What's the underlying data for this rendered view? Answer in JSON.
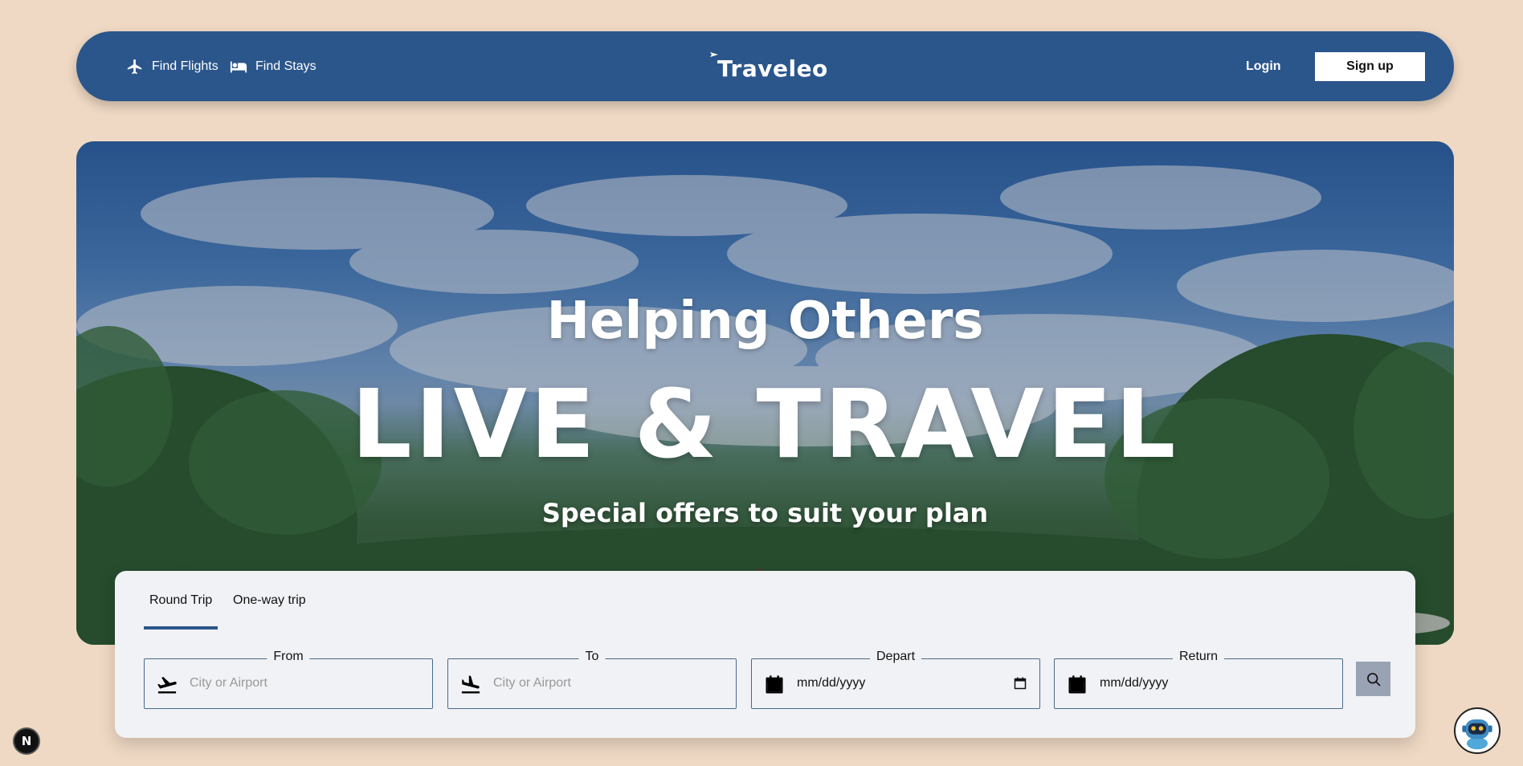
{
  "nav": {
    "flights_label": "Find Flights",
    "stays_label": "Find Stays",
    "brand": "Traveleo",
    "login_label": "Login",
    "signup_label": "Sign up"
  },
  "hero": {
    "line1": "Helping Others",
    "line2": "LIVE & TRAVEL",
    "line3": "Special offers to suit your plan"
  },
  "search": {
    "tabs": [
      {
        "label": "Round Trip",
        "active": true
      },
      {
        "label": "One-way trip",
        "active": false
      }
    ],
    "from": {
      "label": "From",
      "placeholder": "City or Airport"
    },
    "to": {
      "label": "To",
      "placeholder": "City or Airport"
    },
    "depart": {
      "label": "Depart",
      "value": "mm/dd/yyyy"
    },
    "return": {
      "label": "Return",
      "value": "mm/dd/yyyy"
    }
  },
  "badge": {
    "letter": "N"
  },
  "colors": {
    "background": "#efd9c4",
    "navbar": "#2b568b",
    "panel": "#f1f2f5",
    "search_button": "#9aa3b3"
  },
  "icons": [
    "plane-icon",
    "bed-icon",
    "takeoff-icon",
    "landing-icon",
    "calendar-icon",
    "search-icon",
    "chatbot-icon"
  ]
}
